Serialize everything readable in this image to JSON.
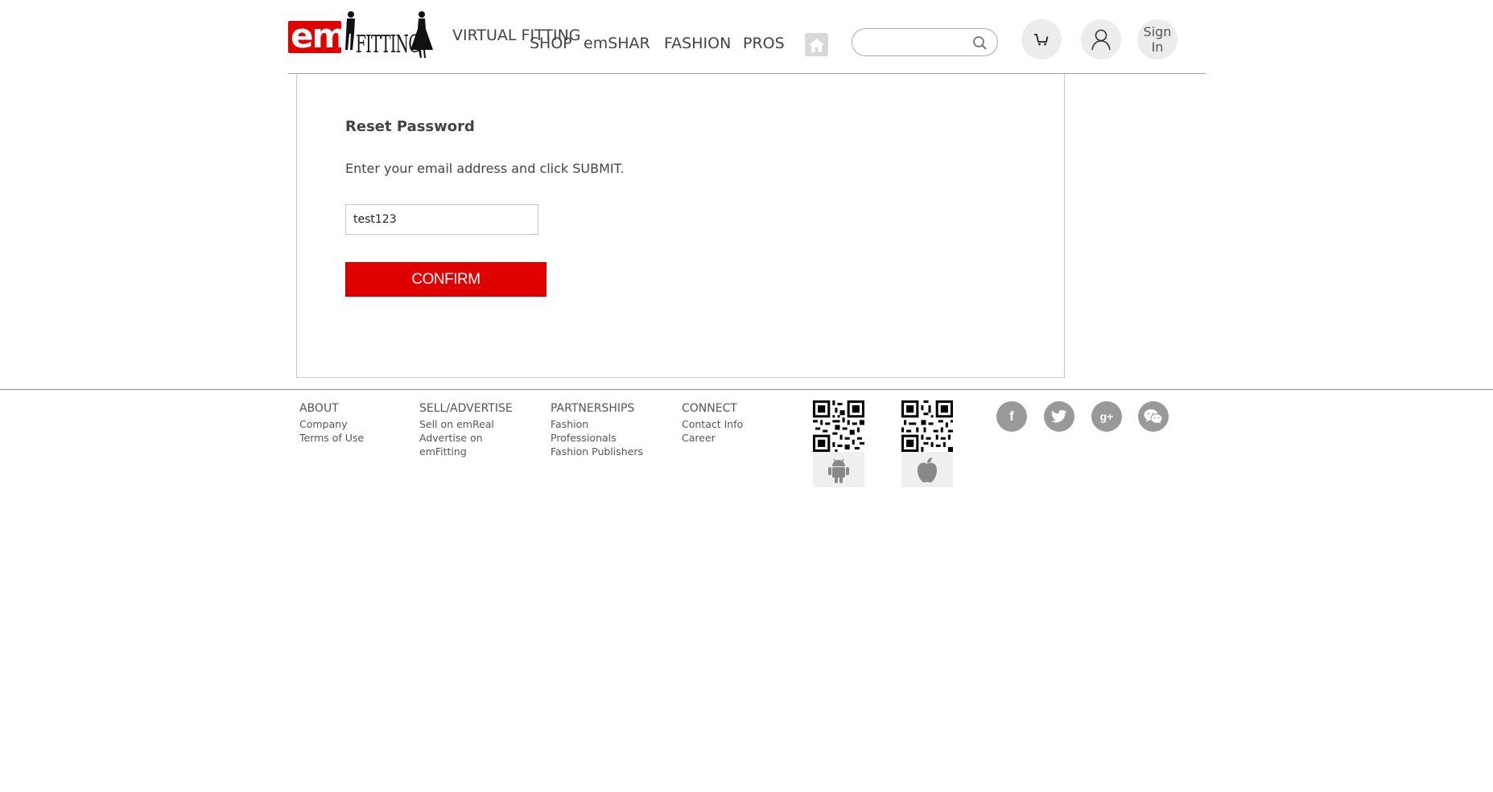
{
  "header": {
    "logo": {
      "em": "em",
      "fitting": "FITTING"
    },
    "nav": {
      "virtual_fitting": "VIRTUAL FITTING",
      "shop": "SHOP",
      "emshare": "emSHARE",
      "fashion": "FASHION",
      "pros": "PROS"
    },
    "search": {
      "placeholder": "",
      "value": ""
    },
    "sign_in": "Sign In"
  },
  "reset": {
    "title": "Reset Password",
    "instruction": "Enter your email address and click SUBMIT.",
    "email_value": "test123",
    "confirm_label": "CONFIRM"
  },
  "footer": {
    "about": {
      "heading": "ABOUT",
      "links": [
        "Company",
        "Terms of Use"
      ]
    },
    "sell": {
      "heading": "SELL/ADVERTISE",
      "links": [
        "Sell on emReal",
        "Advertise on emFitting"
      ]
    },
    "partnerships": {
      "heading": "PARTNERSHIPS",
      "links": [
        "Fashion Professionals",
        "Fashion Publishers"
      ]
    },
    "connect": {
      "heading": "CONNECT",
      "links": [
        "Contact Info",
        "Career"
      ]
    }
  },
  "icons": {
    "home": "home-icon",
    "search": "search-icon",
    "cart": "cart-icon",
    "user": "user-icon",
    "android": "android-icon",
    "apple": "apple-icon",
    "social": [
      "facebook-icon",
      "twitter-icon",
      "google-plus-icon",
      "wechat-icon"
    ]
  },
  "colors": {
    "brand_red": "#e10000",
    "social_gray": "#999999",
    "text": "#444444"
  }
}
